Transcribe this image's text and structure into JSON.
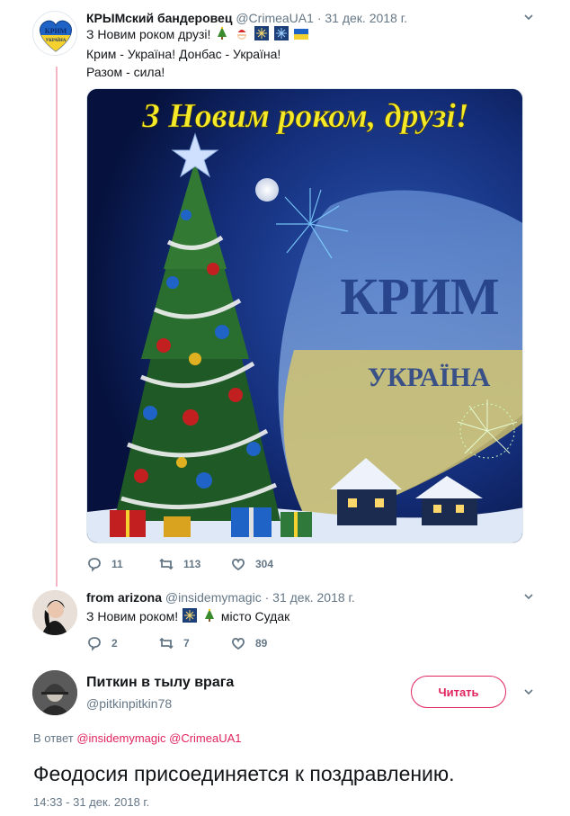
{
  "tweet1": {
    "avatar_text_top": "КРИМ",
    "avatar_text_bottom": "УКРАЇНА",
    "name": "КРЫМский бандеровец",
    "handle": "@CrimeaUA1",
    "separator": "·",
    "date": "31 дек. 2018 г.",
    "lines": [
      "З Новим роком друзі!",
      "Крим - Україна! Донбас - Україна!",
      "Разом - сила!"
    ],
    "image": {
      "headline": "З Новим роком, друзі!",
      "word_top": "КРИМ",
      "word_bottom": "УКРАЇНА"
    },
    "replies": "11",
    "retweets": "113",
    "likes": "304"
  },
  "tweet2": {
    "name": "from arizona",
    "handle": "@insidemymagic",
    "separator": "·",
    "date": "31 дек. 2018 г.",
    "text_before": "З Новим роком!",
    "text_after": "місто Судак",
    "replies": "2",
    "retweets": "7",
    "likes": "89"
  },
  "main": {
    "name": "Питкин в тылу врага",
    "handle": "@pitkinpitkin78",
    "follow_label": "Читать",
    "reply_prefix": "В ответ",
    "reply_user1": "@insidemymagic",
    "reply_user2": "@CrimeaUA1",
    "text": "Феодосия присоединяется к поздравлению.",
    "timestamp": "14:33 - 31 дек. 2018 г."
  },
  "colors": {
    "accent": "#e0245e",
    "muted": "#657786",
    "thread": "#f6b5c7"
  }
}
